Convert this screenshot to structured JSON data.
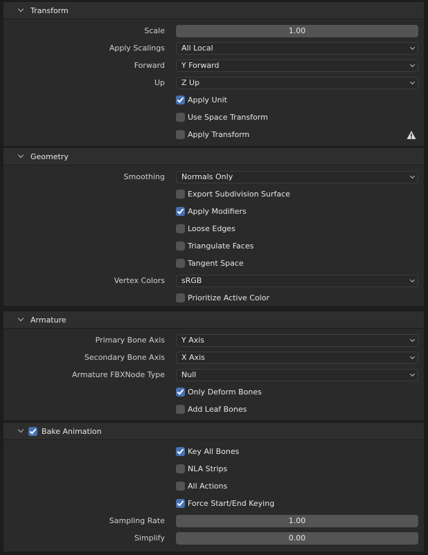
{
  "transform": {
    "header": "Transform",
    "scale_label": "Scale",
    "scale_value": "1.00",
    "apply_scalings_label": "Apply Scalings",
    "apply_scalings_value": "All Local",
    "forward_label": "Forward",
    "forward_value": "Y Forward",
    "up_label": "Up",
    "up_value": "Z Up",
    "apply_unit": "Apply Unit",
    "use_space_transform": "Use Space Transform",
    "apply_transform": "Apply Transform",
    "warning_icon": "warning-icon"
  },
  "geometry": {
    "header": "Geometry",
    "smoothing_label": "Smoothing",
    "smoothing_value": "Normals Only",
    "export_subdivision": "Export Subdivision Surface",
    "apply_modifiers": "Apply Modifiers",
    "loose_edges": "Loose Edges",
    "triangulate_faces": "Triangulate Faces",
    "tangent_space": "Tangent Space",
    "vertex_colors_label": "Vertex Colors",
    "vertex_colors_value": "sRGB",
    "prioritize_active_color": "Prioritize Active Color"
  },
  "armature": {
    "header": "Armature",
    "primary_bone_axis_label": "Primary Bone Axis",
    "primary_bone_axis_value": "Y Axis",
    "secondary_bone_axis_label": "Secondary Bone Axis",
    "secondary_bone_axis_value": "X Axis",
    "node_type_label": "Armature FBXNode Type",
    "node_type_value": "Null",
    "only_deform_bones": "Only Deform Bones",
    "add_leaf_bones": "Add Leaf Bones"
  },
  "bake_animation": {
    "header": "Bake Animation",
    "key_all_bones": "Key All Bones",
    "nla_strips": "NLA Strips",
    "all_actions": "All Actions",
    "force_start_end_keying": "Force Start/End Keying",
    "sampling_rate_label": "Sampling Rate",
    "sampling_rate_value": "1.00",
    "simplify_label": "Simplify",
    "simplify_value": "0.00"
  },
  "colors": {
    "accent": "#4772b3",
    "panel_bg": "#2a2a2a",
    "header_bg": "#2e2e2e",
    "field_bg": "#545454"
  }
}
